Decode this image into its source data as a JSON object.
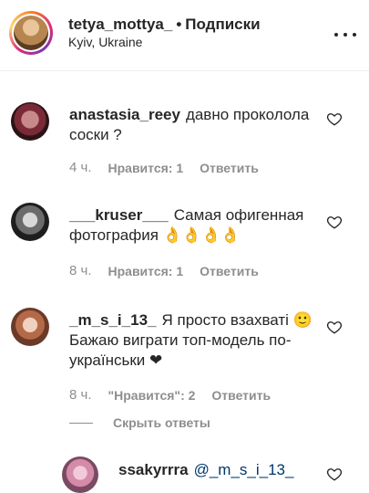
{
  "header": {
    "username": "tetya_mottya_",
    "separator": "•",
    "follow_label": "Подписки",
    "location": "Kyiv, Ukraine"
  },
  "comments": [
    {
      "username": "anastasia_reey",
      "text": "давно проколола соски ?",
      "time": "4 ч.",
      "likes": "Нравится: 1",
      "reply": "Ответить"
    },
    {
      "username": "___kruser___",
      "text": "Самая офигенная фотография 👌👌👌👌",
      "time": "8 ч.",
      "likes": "Нравится: 1",
      "reply": "Ответить"
    },
    {
      "username": "_m_s_i_13_",
      "text": "Я просто взахваті 🙂 Бажаю виграти топ-модель по-українськи ❤",
      "time": "8 ч.",
      "likes": "\"Нравится\": 2",
      "reply": "Ответить",
      "hide_replies": "Скрыть ответы"
    }
  ],
  "reply": {
    "username": "ssakyrrra",
    "mention": "@_m_s_i_13_"
  },
  "colors": {
    "text": "#262626",
    "secondary": "#8e8e8e",
    "mention": "#00376b",
    "divider": "#efefef"
  },
  "icons": [
    "more-icon",
    "heart-icon"
  ]
}
